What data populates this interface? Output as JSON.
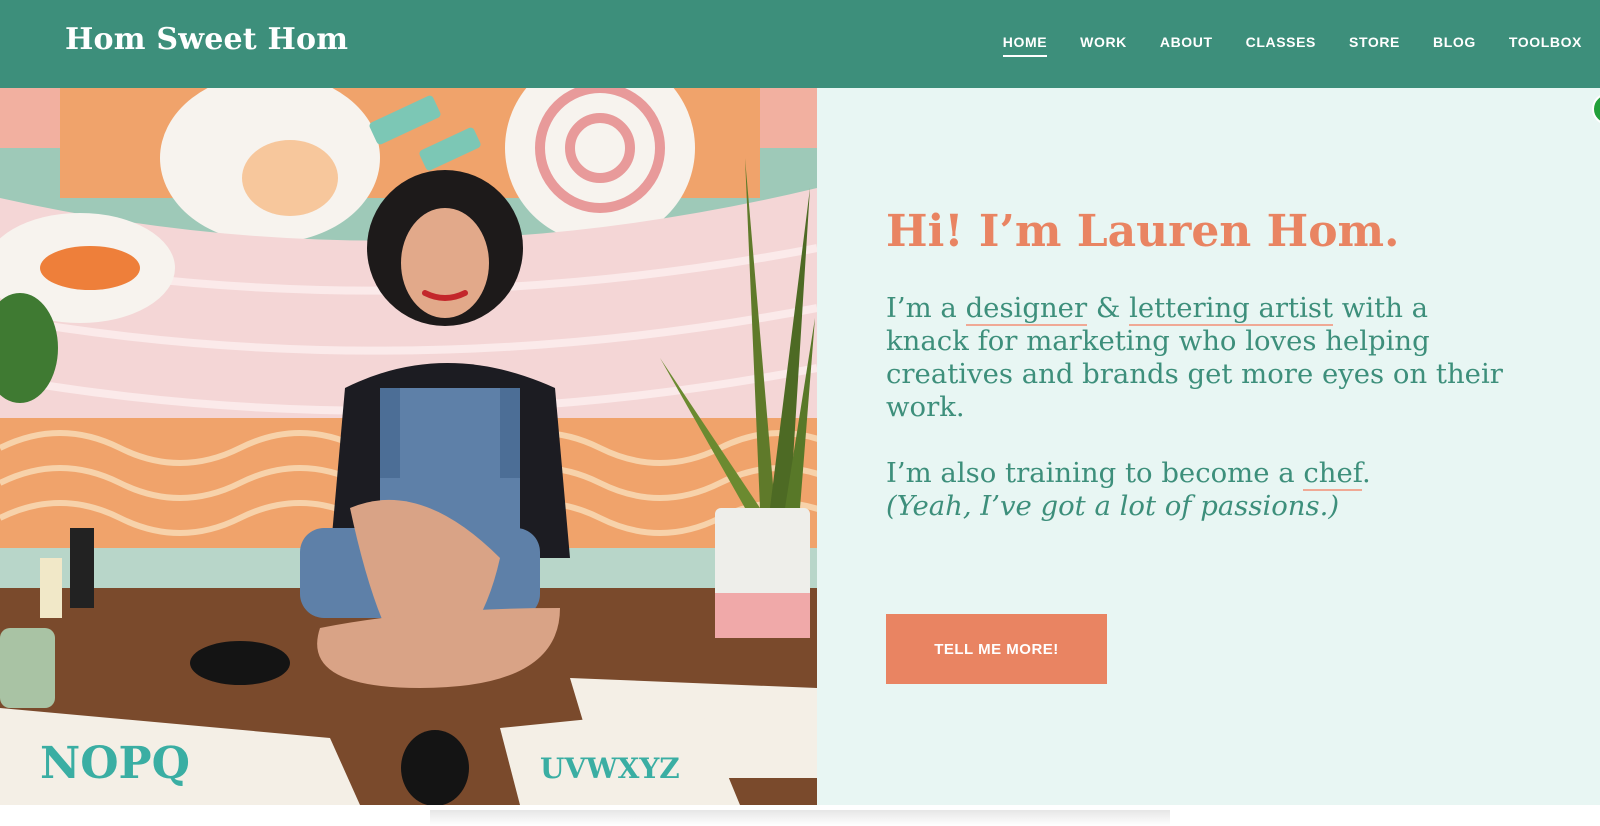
{
  "header": {
    "logo": "Hom Sweet Hom",
    "nav": [
      "HOME",
      "WORK",
      "ABOUT",
      "CLASSES",
      "STORE",
      "BLOG",
      "TOOLBOX"
    ],
    "active_nav": "HOME"
  },
  "hero": {
    "headline": "Hi! I’m Lauren Hom.",
    "intro": {
      "p1": "I’m a ",
      "link1": "designer",
      "p2": " & ",
      "link2": "lettering artist",
      "p3": " with a knack for marketing who loves helping creatives and brands get more eyes on their work."
    },
    "passion": {
      "p1": "I’m also training to become a ",
      "link": "chef",
      "p2": ".",
      "aside": "(Yeah, I’ve got a lot of passions.)"
    },
    "cta": "TELL ME MORE!",
    "photo_alt": "Lauren Hom sitting on the floor in front of a colorful ramen mural with a snake plant and lettering sheets"
  },
  "colors": {
    "header_bg": "#3d8f7b",
    "accent": "#e98462",
    "panel_bg": "#e8f6f3",
    "text_teal": "#3d8f7b"
  }
}
